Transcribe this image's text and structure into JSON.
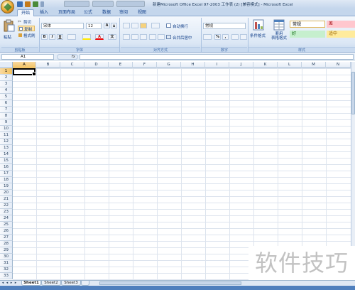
{
  "window": {
    "title": "新建Microsoft Office Excel 97-2003 工作表 (2) [兼容模式] - Microsoft Excel"
  },
  "tabs": [
    "开始",
    "插入",
    "页面布局",
    "公式",
    "数据",
    "审阅",
    "视图"
  ],
  "clipboard": {
    "paste": "粘贴",
    "cut": "剪切",
    "copy": "复制",
    "format_painter": "格式刷",
    "group": "剪贴板"
  },
  "font": {
    "name": "宋体",
    "size": "12",
    "group": "字体"
  },
  "alignment": {
    "wrap": "自动换行",
    "merge": "合并后居中",
    "group": "对齐方式"
  },
  "number": {
    "format": "常规",
    "group": "数字"
  },
  "styles": {
    "conditional": "条件格式",
    "table_format": "套用\n表格格式",
    "normal": "常规",
    "bad": "差",
    "good": "好",
    "neutral": "适中",
    "group": "样式"
  },
  "formula_bar": {
    "name_box": "A1",
    "fx": "fx",
    "value": ""
  },
  "columns": [
    "A",
    "B",
    "C",
    "D",
    "E",
    "F",
    "G",
    "H",
    "I",
    "J",
    "K",
    "L",
    "M",
    "N"
  ],
  "rows": [
    "1",
    "2",
    "3",
    "4",
    "5",
    "6",
    "7",
    "8",
    "9",
    "10",
    "11",
    "12",
    "13",
    "14",
    "15",
    "16",
    "17",
    "18",
    "19",
    "20",
    "21",
    "22",
    "23",
    "24",
    "25",
    "26",
    "27",
    "28",
    "29",
    "30",
    "31",
    "32",
    "33"
  ],
  "sheets": [
    "Sheet1",
    "Sheet2",
    "Sheet3"
  ],
  "active_cell": "A1",
  "watermark": "软件技巧",
  "colors": {
    "accent": "#4f7fbd",
    "selected_header": "#f1c15f",
    "style_bad_bg": "#ffc7ce",
    "style_good_bg": "#c6efce",
    "style_neutral_bg": "#ffeb9c"
  }
}
